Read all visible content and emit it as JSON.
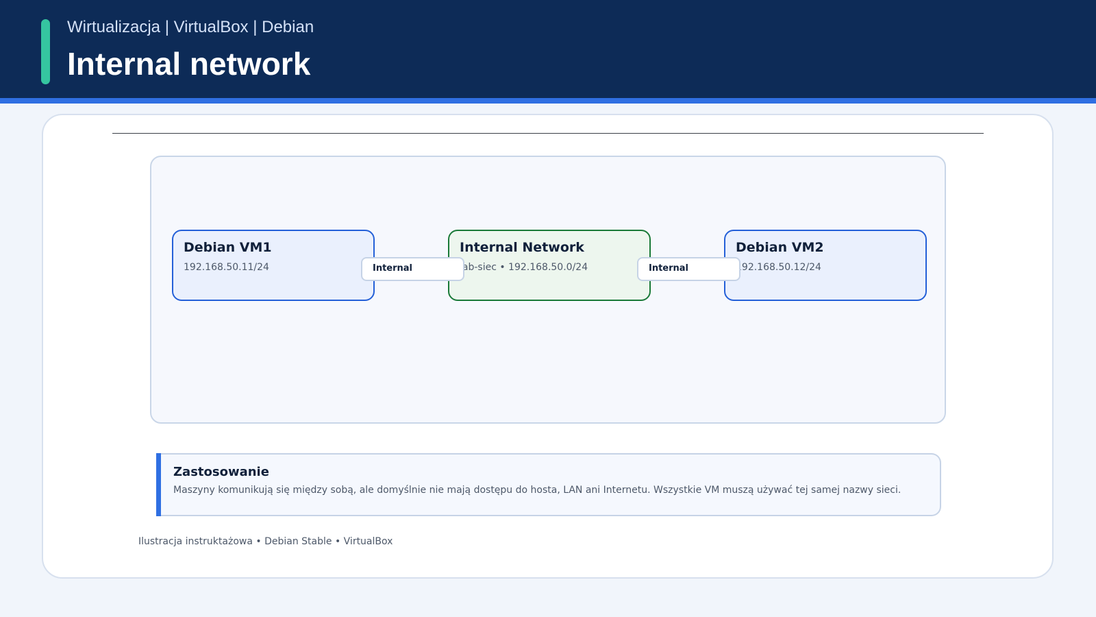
{
  "header": {
    "subtitle": "Wirtualizacja | VirtualBox | Debian",
    "title": "Internal network"
  },
  "diagram": {
    "nodes": [
      {
        "title": "Debian VM1",
        "detail": "192.168.50.11/24"
      },
      {
        "title": "Internal Network",
        "detail": "lab-siec • 192.168.50.0/24"
      },
      {
        "title": "Debian VM2",
        "detail": "192.168.50.12/24"
      }
    ],
    "links": [
      {
        "label": "Internal"
      },
      {
        "label": "Internal"
      }
    ]
  },
  "note": {
    "title": "Zastosowanie",
    "text": "Maszyny komunikują się między sobą, ale domyślnie nie mają dostępu do hosta, LAN ani Internetu. Wszystkie VM muszą używać tej samej nazwy sieci."
  },
  "footer": "Ilustracja instruktażowa • Debian Stable • VirtualBox",
  "colors": {
    "header_bg": "#0d2b57",
    "accent": "#2f6fe2",
    "accent_teal": "#35c5a0",
    "vm_border": "#2460d8",
    "network_border": "#1a7a38"
  }
}
